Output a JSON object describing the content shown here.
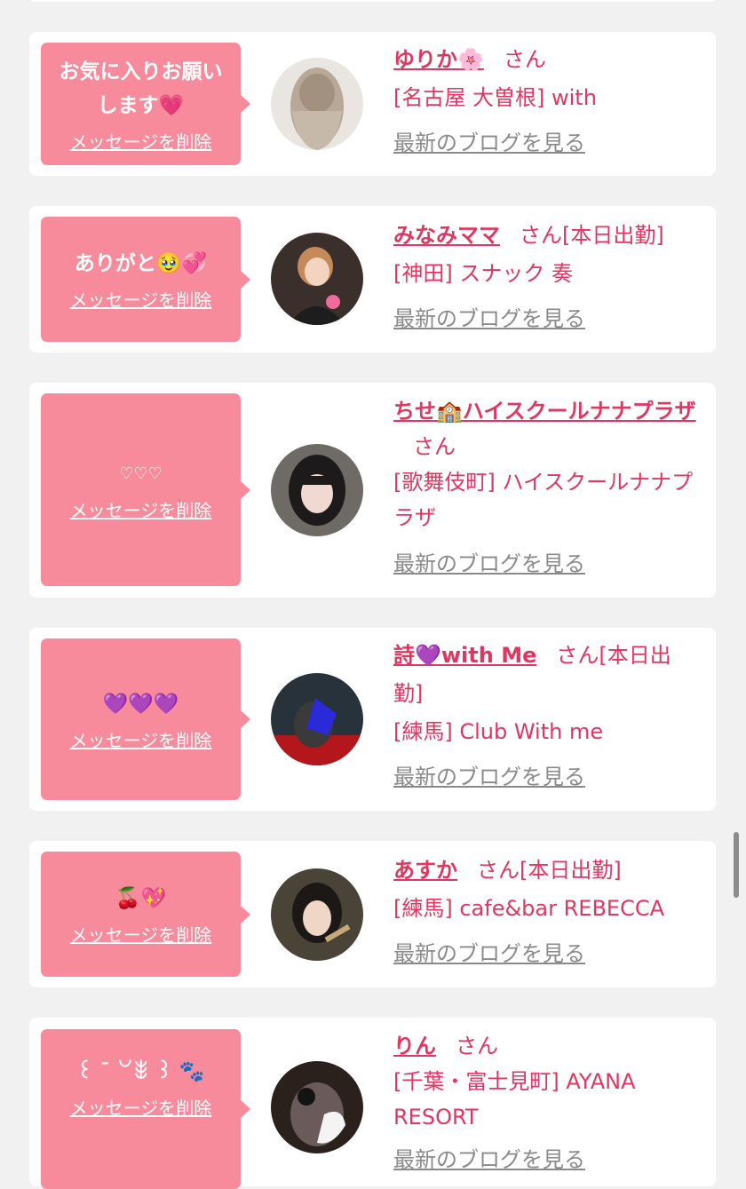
{
  "delete_label": "メッセージを削除",
  "blog_label": "最新のブログを見る",
  "honorific": "さん",
  "cards": [
    {
      "message": "お気に入りお願いします💗",
      "name": "ゆりか🌸",
      "status": "",
      "shop": "[名古屋 大曽根] with"
    },
    {
      "message": "ありがと🥹💞",
      "name": "みなみママ",
      "status": "[本日出勤]",
      "shop": "[神田] スナック 奏"
    },
    {
      "message": "♡♡♡",
      "name": "ちせ🏫ハイスクールナナプラザ",
      "status": "",
      "shop": "[歌舞伎町] ハイスクールナナプラザ"
    },
    {
      "message": "💜💜💜",
      "name": "詩💜with Me",
      "status": "[本日出勤]",
      "shop": "[練馬] Club With me"
    },
    {
      "message": "🍒💖",
      "name": "あすか",
      "status": "[本日出勤]",
      "shop": "[練馬] cafe&bar REBECCA"
    },
    {
      "message": "꒰ ¯ ꒡ꎺ ꒱ 🐾",
      "name": "りん",
      "status": "",
      "shop": "[千葉・富士見町] AYANA RESORT"
    }
  ],
  "colors": {
    "accent": "#e0365f",
    "bubble": "#f78a9b",
    "background": "#f1f1f1",
    "link_gray": "#8a8a8a"
  }
}
